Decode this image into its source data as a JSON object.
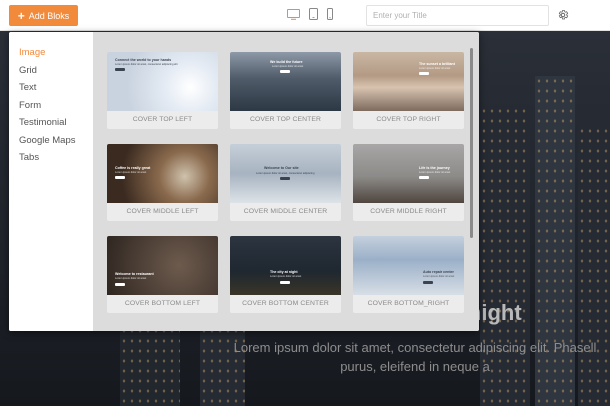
{
  "toolbar": {
    "add_label": "Add Bloks",
    "add_icon": "plus-icon",
    "title_placeholder": "Enter your Title",
    "devices": [
      "desktop-icon",
      "tablet-icon",
      "mobile-icon"
    ],
    "settings_icon": "gear-icon",
    "accent": "#f28a3b"
  },
  "sidebar": {
    "items": [
      {
        "label": "Image",
        "active": true
      },
      {
        "label": "Grid",
        "active": false
      },
      {
        "label": "Text",
        "active": false
      },
      {
        "label": "Form",
        "active": false
      },
      {
        "label": "Testimonial",
        "active": false
      },
      {
        "label": "Google Maps",
        "active": false
      },
      {
        "label": "Tabs",
        "active": false
      }
    ]
  },
  "templates": [
    {
      "label": "COVER TOP LEFT",
      "heading": "Connect the world to your hands",
      "sub": "Lorem ipsum dolor sit amet, consectetur adipiscing elit"
    },
    {
      "label": "COVER TOP CENTER",
      "heading": "We build the future",
      "sub": "Lorem ipsum dolor sit amet"
    },
    {
      "label": "COVER TOP RIGHT",
      "heading": "The sunset a brilliant",
      "sub": "Lorem ipsum dolor sit amet"
    },
    {
      "label": "COVER MIDDLE LEFT",
      "heading": "Coffee is really great",
      "sub": "Lorem ipsum dolor sit amet"
    },
    {
      "label": "COVER MIDDLE CENTER",
      "heading": "Welcome to Our site",
      "sub": "Lorem ipsum dolor sit amet, consectetur adipiscing"
    },
    {
      "label": "COVER MIDDLE RIGHT",
      "heading": "Life is the journey",
      "sub": "Lorem ipsum dolor sit amet"
    },
    {
      "label": "COVER BOTTOM LEFT",
      "heading": "Welcome to restaurant",
      "sub": "Lorem ipsum dolor sit amet"
    },
    {
      "label": "COVER BOTTOM CENTER",
      "heading": "The city at night",
      "sub": "Lorem ipsum dolor sit amet"
    },
    {
      "label": "COVER BOTTOM_RIGHT",
      "heading": "Auto repair center",
      "sub": "Lorem ipsum dolor sit amet"
    }
  ],
  "background": {
    "heading": "The city at night",
    "paragraph_line1": "Lorem ipsum dolor sit amet, consectetur adipiscing elit. Phasell",
    "paragraph_line2": "purus, eleifend in neque a"
  }
}
